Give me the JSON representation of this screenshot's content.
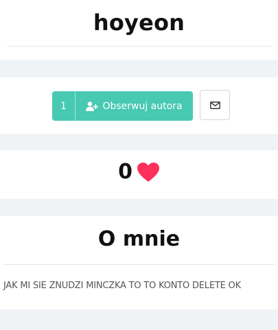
{
  "profile": {
    "username": "hoyeon"
  },
  "follow": {
    "count": "1",
    "button_label": "Obserwuj autora",
    "icon": "user-plus-icon"
  },
  "message": {
    "icon": "envelope-icon"
  },
  "likes": {
    "count": "0",
    "icon": "heart-icon"
  },
  "about": {
    "heading": "O mnie",
    "text": "JAK MI SIE ZNUDZI MINCZKA TO TO KONTO DELETE OK"
  },
  "colors": {
    "accent": "#47c9b2",
    "heart": "#ff2f5b",
    "background": "#f0f3f6"
  }
}
